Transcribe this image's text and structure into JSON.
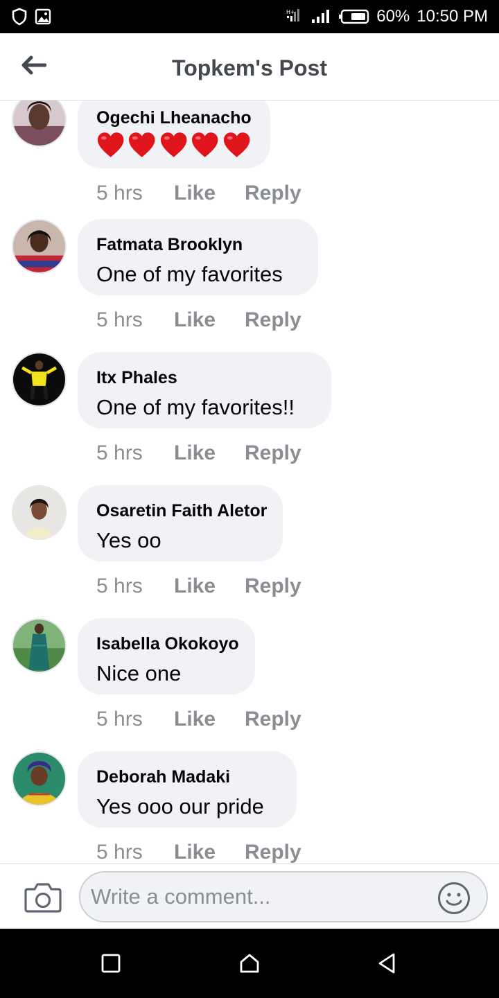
{
  "status_bar": {
    "battery": "60%",
    "time": "10:50 PM",
    "icons": [
      "shield-icon",
      "image-icon",
      "data-signal-icon",
      "signal-icon",
      "battery-icon"
    ]
  },
  "header": {
    "title": "Topkem's Post",
    "back_icon": "back-arrow-icon"
  },
  "comments": [
    {
      "name": "Ogechi Lheanacho",
      "text": "",
      "hearts": 5,
      "time": "5 hrs",
      "like": "Like",
      "reply": "Reply"
    },
    {
      "name": "Fatmata Brooklyn",
      "text": "One of my favorites",
      "time": "5 hrs",
      "like": "Like",
      "reply": "Reply"
    },
    {
      "name": "Itx Phales",
      "text": "One of my favorites!!",
      "time": "5 hrs",
      "like": "Like",
      "reply": "Reply"
    },
    {
      "name": "Osaretin Faith Aletor",
      "text": "Yes oo",
      "time": "5 hrs",
      "like": "Like",
      "reply": "Reply"
    },
    {
      "name": "Isabella Okokoyo",
      "text": "Nice one",
      "time": "5 hrs",
      "like": "Like",
      "reply": "Reply"
    },
    {
      "name": "Deborah Madaki",
      "text": "Yes ooo our pride",
      "time": "5 hrs",
      "like": "Like",
      "reply": "Reply"
    }
  ],
  "composer": {
    "placeholder": "Write a comment...",
    "camera_icon": "camera-icon",
    "emoji_icon": "emoji-icon"
  },
  "nav_bar": {
    "icons": [
      "recent-apps-icon",
      "home-icon",
      "back-icon"
    ]
  },
  "colors": {
    "bubble": "#f0f2f5",
    "meta_text": "#8a8d91",
    "title": "#444950",
    "heart": "#e0151b"
  }
}
